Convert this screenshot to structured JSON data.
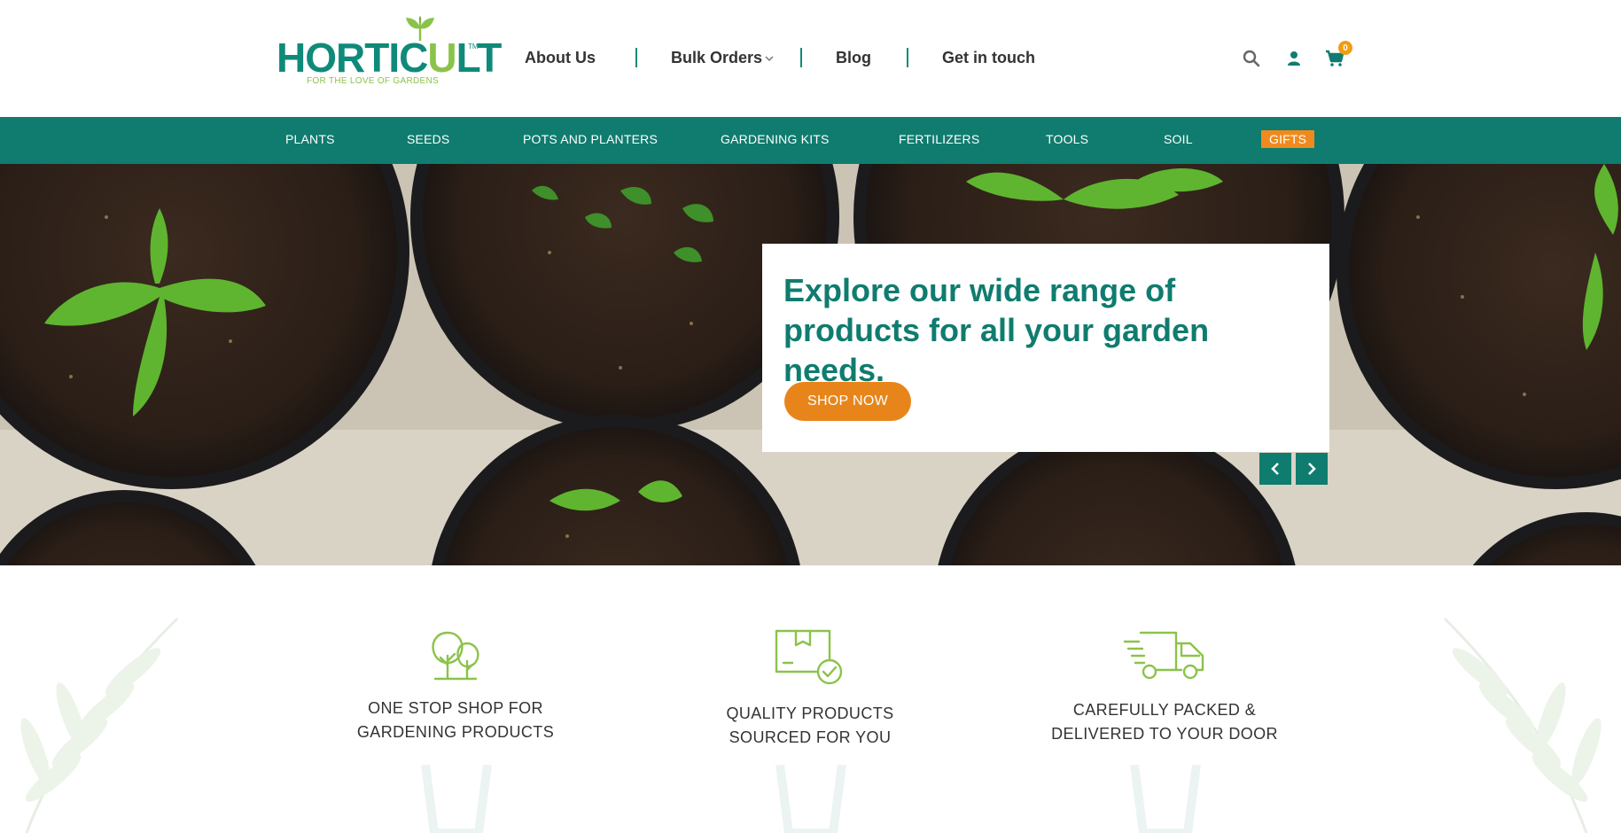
{
  "brand": {
    "name_part1": "HORTIC",
    "name_u": "U",
    "name_part2": "LT",
    "tm": "TM",
    "tagline": "FOR THE LOVE OF GARDENS"
  },
  "topnav": {
    "items": [
      {
        "label": "About Us"
      },
      {
        "label": "Bulk Orders"
      },
      {
        "label": "Blog"
      },
      {
        "label": "Get in touch"
      }
    ]
  },
  "header_icons": {
    "search": "search-icon",
    "account": "user-icon",
    "cart": "cart-icon",
    "cart_count": "0"
  },
  "categories": [
    {
      "label": "PLANTS"
    },
    {
      "label": "SEEDS"
    },
    {
      "label": "POTS AND PLANTERS"
    },
    {
      "label": "GARDENING KITS"
    },
    {
      "label": "FERTILIZERS"
    },
    {
      "label": "TOOLS"
    },
    {
      "label": "SOIL"
    },
    {
      "label": "GIFTS"
    }
  ],
  "hero": {
    "headline": "Explore our wide range of products for all your garden needs.",
    "cta": "SHOP NOW",
    "prev_icon": "chevron-left-icon",
    "next_icon": "chevron-right-icon"
  },
  "features": [
    {
      "icon": "trees-icon",
      "line1": "ONE STOP SHOP FOR",
      "line2": "GARDENING PRODUCTS"
    },
    {
      "icon": "box-check-icon",
      "line1": "QUALITY PRODUCTS",
      "line2": "SOURCED FOR YOU"
    },
    {
      "icon": "delivery-truck-icon",
      "line1": "CAREFULLY PACKED &",
      "line2": "DELIVERED TO YOUR DOOR"
    }
  ],
  "colors": {
    "teal": "#0f7c6f",
    "brand_teal": "#0f8a7a",
    "orange": "#e8851a",
    "leaf_green": "#8bc34a"
  }
}
